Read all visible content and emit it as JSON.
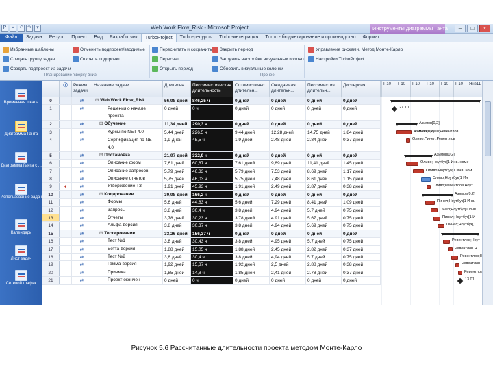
{
  "window": {
    "title": "Web Work Flow_Risk - Microsoft Project",
    "context_tab_title": "Инструменты диаграммы Ганта",
    "controls": [
      "–",
      "□",
      "×"
    ]
  },
  "tabs": [
    {
      "label": "Файл"
    },
    {
      "label": "Задача"
    },
    {
      "label": "Ресурс"
    },
    {
      "label": "Проект"
    },
    {
      "label": "Вид"
    },
    {
      "label": "Разработчик"
    },
    {
      "label": "TurboProject"
    },
    {
      "label": "Turbo-ресурсы"
    },
    {
      "label": "Turbo-интеграция"
    },
    {
      "label": "Turbo - бюджетирование и производство"
    },
    {
      "label": "Формат"
    }
  ],
  "ribbon": {
    "col1": [
      "Избранные шаблоны",
      "Создать группу задач",
      "Создать подпроект из задачи"
    ],
    "col2": [
      "Отменить подпроект/вводимые",
      "Открыть подпроект"
    ],
    "col3": [
      "Пересчитать и сохранить",
      "Пересчет",
      "Открыть период"
    ],
    "col4": [
      "Закрыть период",
      "Загрузить настройки визуальных колонок",
      "Обновить визуальные колонки"
    ],
    "col5": [
      "Управление рисками. Метод Монте-Карло",
      "Настройки TurboProject"
    ],
    "group1": "Планирование 'сверху вниз'",
    "group2": "Прочее"
  },
  "viewbar": [
    {
      "label": "Временная шкала"
    },
    {
      "label": "Диаграмма Ганта"
    },
    {
      "label": "Диаграмма Ганта с ..."
    },
    {
      "label": "Использование задач"
    },
    {
      "label": "Календарь"
    },
    {
      "label": "Лист задач"
    },
    {
      "label": "Сетевой график"
    }
  ],
  "columns": {
    "mode": "Режим задачи",
    "name": "Название задачи",
    "duration": "Длительн...",
    "pessimistic_risk": "Пессимистическая длительность",
    "optimistic": "Оптимистичес... длительн...",
    "expected": "Ожидаемая длительн...",
    "pessimistic": "Пессимистич... длительн...",
    "variance": "Дисперсия"
  },
  "rows": [
    {
      "id": "0",
      "name": "Web Work Flow_Risk",
      "dur": "56,98 дней",
      "risk": "846,25 ч",
      "opt": "0 дней",
      "exp": "0 дней",
      "pes": "0 дней",
      "var": "0 дней",
      "type": "project"
    },
    {
      "id": "1",
      "name": "Решения о начале проекта",
      "dur": "0 дней",
      "risk": "0 ч",
      "opt": "0 дней",
      "exp": "0 дней",
      "pes": "0 дней",
      "var": "0 дней",
      "type": "tall"
    },
    {
      "id": "2",
      "name": "Обучение",
      "dur": "11,34 дней",
      "risk": "290,3 ч",
      "opt": "0 дней",
      "exp": "0 дней",
      "pes": "0 дней",
      "var": "0 дней",
      "type": "summary"
    },
    {
      "id": "3",
      "name": "Курсы по NET 4.0",
      "dur": "5,44 дней",
      "risk": "226,5 ч",
      "opt": "9,44 дней",
      "exp": "12,28 дней",
      "pes": "14,75 дней",
      "var": "1.84 дней",
      "type": "task"
    },
    {
      "id": "4",
      "name": "Сертификация по NET 4.0",
      "dur": "1,9 дней",
      "risk": "45,5 ч",
      "opt": "1,9 дней",
      "exp": "2.48 дней",
      "pes": "2.84 дней",
      "var": "0.37 дней",
      "type": "tall"
    },
    {
      "id": "5",
      "name": "Постановка",
      "dur": "21,97 дней",
      "risk": "332,9 ч",
      "opt": "0 дней",
      "exp": "0 дней",
      "pes": "0 дней",
      "var": "0 дней",
      "type": "summary"
    },
    {
      "id": "6",
      "name": "Описание форм",
      "dur": "7,61 дней",
      "risk": "60,87 ч",
      "opt": "7,61 дней",
      "exp": "9,89 дней",
      "pes": "11,41 дней",
      "var": "1.45 дней",
      "type": "task"
    },
    {
      "id": "7",
      "name": "Описание запросов",
      "dur": "5,79 дней",
      "risk": "46,33 ч",
      "opt": "5,79 дней",
      "exp": "7,53 дней",
      "pes": "8.69 дней",
      "var": "1,17 дней",
      "type": "task"
    },
    {
      "id": "8",
      "name": "Описание отчетов",
      "dur": "5,75 дней",
      "risk": "46,03 ч",
      "opt": "5,75 дней",
      "exp": "7,48 дней",
      "pes": "8.61 дней",
      "var": "1.15 дней",
      "type": "task"
    },
    {
      "id": "9",
      "name": "Утверждение ТЗ",
      "dur": "1,91 дней",
      "risk": "45,93 ч",
      "opt": "1,91 дней",
      "exp": "2,49 дней",
      "pes": "2.87 дней",
      "var": "0.38 дней",
      "type": "task",
      "warn": true
    },
    {
      "id": "10",
      "name": "Кодирование",
      "dur": "30,98 дней",
      "risk": "166,2 ч",
      "opt": "0 дней",
      "exp": "0 дней",
      "pes": "0 дней",
      "var": "0 дней",
      "type": "summary"
    },
    {
      "id": "11",
      "name": "Формы",
      "dur": "5,6 дней",
      "risk": "44,83 ч",
      "opt": "5,6 дней",
      "exp": "7,29 дней",
      "pes": "8.41 дней",
      "var": "1.09 дней",
      "type": "task"
    },
    {
      "id": "12",
      "name": "Запросы",
      "dur": "3,8 дней",
      "risk": "30,4 ч",
      "opt": "3,8 дней",
      "exp": "4,94 дней",
      "pes": "5.7 дней",
      "var": "0.75 дней",
      "type": "task"
    },
    {
      "id": "13",
      "name": "Отчеты",
      "dur": "3,78 дней",
      "risk": "30,23 ч",
      "opt": "3,78 дней",
      "exp": "4.91 дней",
      "pes": "5.67 дней",
      "var": "0.75 дней",
      "type": "task",
      "highlight": true
    },
    {
      "id": "14",
      "name": "Альфа-версия",
      "dur": "3,8 дней",
      "risk": "30,37 ч",
      "opt": "3,8 дней",
      "exp": "4,94 дней",
      "pes": "5.69 дней",
      "var": "0.75 дней",
      "type": "task"
    },
    {
      "id": "15",
      "name": "Тестирование",
      "dur": "33,26 дней",
      "risk": "156,37 ч",
      "opt": "0 дней",
      "exp": "0 дней",
      "pes": "0 дней",
      "var": "0 дней",
      "type": "summary"
    },
    {
      "id": "16",
      "name": "Тест №1",
      "dur": "3,8 дней",
      "risk": "30,43 ч",
      "opt": "3,8 дней",
      "exp": "4,95 дней",
      "pes": "5.7 дней",
      "var": "0.75 дней",
      "type": "task"
    },
    {
      "id": "17",
      "name": "Бетта-версия",
      "dur": "1.88 дней",
      "risk": "15.05 ч",
      "opt": "1.88 дней",
      "exp": "2.45 дней",
      "pes": "2.82 дней",
      "var": "0.37 дней",
      "type": "task"
    },
    {
      "id": "18",
      "name": "Тест №2",
      "dur": "3,8 дней",
      "risk": "30,4 ч",
      "opt": "3,8 дней",
      "exp": "4,94 дней",
      "pes": "5.7 дней",
      "var": "0.75 дней",
      "type": "task"
    },
    {
      "id": "19",
      "name": "Гамма-версия",
      "dur": "1,92 дней",
      "risk": "15,37 ч",
      "opt": "1,92 дней",
      "exp": "2,5 дней",
      "pes": "2.88 дней",
      "var": "0.38 дней",
      "type": "task"
    },
    {
      "id": "20",
      "name": "Приемка",
      "dur": "1,85 дней",
      "risk": "14,8 ч",
      "opt": "1,85 дней",
      "exp": "2,41 дней",
      "pes": "2.78 дней",
      "var": "0.37 дней",
      "type": "task"
    },
    {
      "id": "21",
      "name": "Проект окончен",
      "dur": "0 дней",
      "risk": "0 ч",
      "opt": "0 дней",
      "exp": "0 дней",
      "pes": "0 дней",
      "var": "0 дней",
      "type": "task"
    }
  ],
  "gantt": {
    "timescale": [
      "Т ",
      "10",
      "Т ",
      "10",
      "Т ",
      "10",
      "Т ",
      "10",
      "Т ",
      "10",
      "Т ",
      "10",
      "Янв",
      "11"
    ],
    "labels": [
      "27.10",
      "Азимов[0,2]",
      "Оливо;Пинел;Ревентлов",
      "Сливо;Пинел;Ревентлов",
      "Азимов[0,2]",
      "Оливо;Ноутбук[1 Инв. номе",
      "Оливо;Ноутбук[1 Инв. ном",
      "Сливо;Ноутбук[1 Ин",
      "Оливо;Ревентлов;Ноут",
      "Азимов[0,2]",
      "Пинел;Ноутбук[1 Инв.",
      "Гэнел;Ноутбук[1 Инв.",
      "Пинел;Ноутбук[1 И",
      "Пинел;Ноутбук[1",
      "Ревентлов;Ноут",
      "Ревентлов Н",
      "Ревентлов;Н",
      "Ревентлов",
      "Ревентлов",
      "13.01"
    ]
  },
  "caption": "Рисунок 5.6 Рассчитанные длительности проекта методом Монте-Карло"
}
